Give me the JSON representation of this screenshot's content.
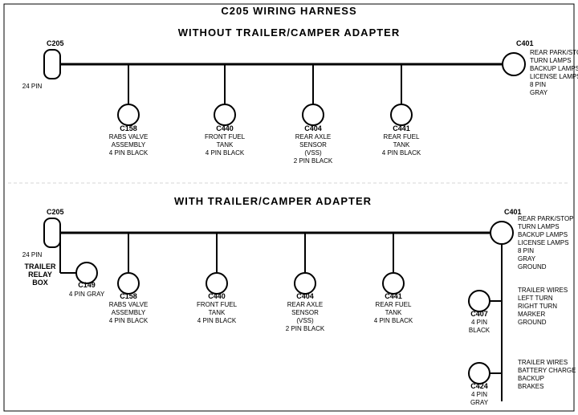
{
  "title": "C205 WIRING HARNESS",
  "section1": {
    "title": "WITHOUT  TRAILER/CAMPER  ADAPTER",
    "left_connector": {
      "id": "C205",
      "pins": "24 PIN"
    },
    "right_connector": {
      "id": "C401",
      "pins": "8 PIN",
      "color": "GRAY",
      "labels": [
        "REAR PARK/STOP",
        "TURN LAMPS",
        "BACKUP LAMPS",
        "LICENSE LAMPS"
      ]
    },
    "connectors": [
      {
        "id": "C158",
        "line1": "RABS VALVE",
        "line2": "ASSEMBLY",
        "line3": "4 PIN BLACK"
      },
      {
        "id": "C440",
        "line1": "FRONT FUEL",
        "line2": "TANK",
        "line3": "4 PIN BLACK"
      },
      {
        "id": "C404",
        "line1": "REAR AXLE",
        "line2": "SENSOR",
        "line3": "(VSS)",
        "line4": "2 PIN BLACK"
      },
      {
        "id": "C441",
        "line1": "REAR FUEL",
        "line2": "TANK",
        "line3": "4 PIN BLACK"
      }
    ]
  },
  "section2": {
    "title": "WITH  TRAILER/CAMPER  ADAPTER",
    "left_connector": {
      "id": "C205",
      "pins": "24 PIN"
    },
    "right_connector": {
      "id": "C401",
      "pins": "8 PIN",
      "color": "GRAY",
      "labels": [
        "REAR PARK/STOP",
        "TURN LAMPS",
        "BACKUP LAMPS",
        "LICENSE LAMPS",
        "GROUND"
      ]
    },
    "trailer_relay": {
      "id": "C149",
      "pins": "4 PIN GRAY",
      "label": "TRAILER RELAY BOX"
    },
    "connectors": [
      {
        "id": "C158",
        "line1": "RABS VALVE",
        "line2": "ASSEMBLY",
        "line3": "4 PIN BLACK"
      },
      {
        "id": "C440",
        "line1": "FRONT FUEL",
        "line2": "TANK",
        "line3": "4 PIN BLACK"
      },
      {
        "id": "C404",
        "line1": "REAR AXLE",
        "line2": "SENSOR",
        "line3": "(VSS)",
        "line4": "2 PIN BLACK"
      },
      {
        "id": "C441",
        "line1": "REAR FUEL",
        "line2": "TANK",
        "line3": "4 PIN BLACK"
      }
    ],
    "right_extra": [
      {
        "id": "C407",
        "pins": "4 PIN BLACK",
        "labels": [
          "TRAILER WIRES",
          "LEFT TURN",
          "RIGHT TURN",
          "MARKER",
          "GROUND"
        ]
      },
      {
        "id": "C424",
        "pins": "4 PIN GRAY",
        "labels": [
          "TRAILER WIRES",
          "BATTERY CHARGE",
          "BACKUP",
          "BRAKES"
        ]
      }
    ]
  }
}
